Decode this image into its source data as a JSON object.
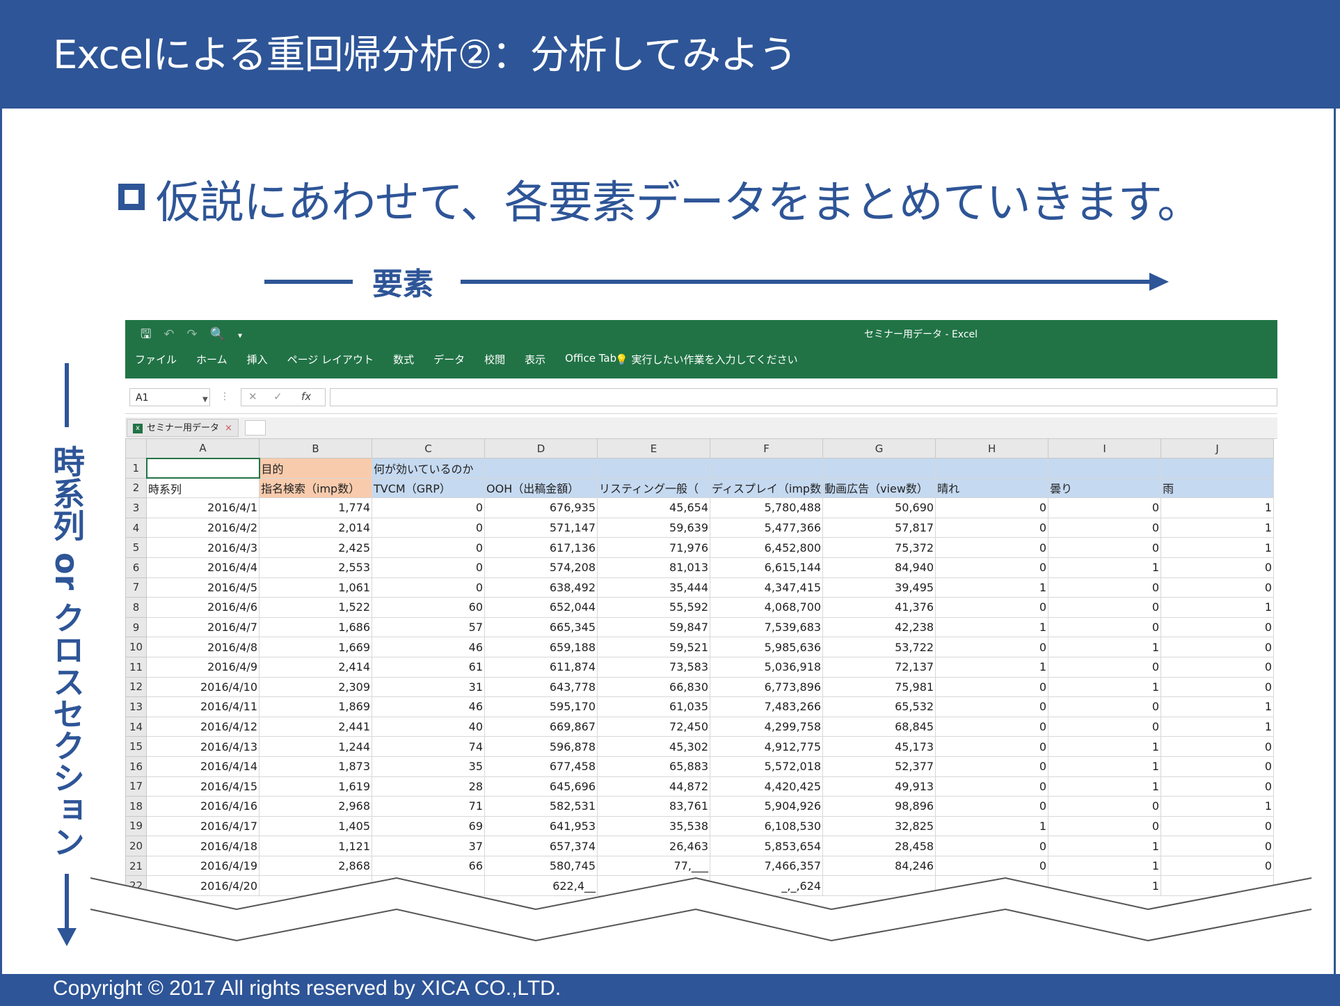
{
  "slide": {
    "title": "Excelによる重回帰分析②：分析してみよう",
    "headline": "仮説にあわせて、各要素データをまとめていきます。",
    "element_label": "要素",
    "side_label": "時系列 or クロスセクション",
    "footer": "Copyright © 2017 All rights reserved by XICA CO.,LTD.",
    "colors": {
      "brand": "#2e5597",
      "excel_green": "#217346",
      "header_blue": "#c5d9f0",
      "header_orange": "#f8cbad"
    }
  },
  "excel": {
    "window_title": "セミナー用データ - Excel",
    "menu": [
      "ファイル",
      "ホーム",
      "挿入",
      "ページ レイアウト",
      "数式",
      "データ",
      "校閲",
      "表示",
      "Office Tab"
    ],
    "tell_me": "実行したい作業を入力してください",
    "name_box": "A1",
    "doc_tab": "セミナー用データ",
    "columns": [
      "A",
      "B",
      "C",
      "D",
      "E",
      "F",
      "G",
      "H",
      "I",
      "J"
    ],
    "row1": [
      "",
      "目的",
      "何が効いているのか",
      "",
      "",
      "",
      "",
      "",
      "",
      ""
    ],
    "row2": [
      "時系列",
      "指名検索（imp数）",
      "TVCM（GRP）",
      "OOH（出稿金額）",
      "リスティング一般（",
      "ディスプレイ（imp数",
      "動画広告（view数）",
      "晴れ",
      "曇り",
      "雨"
    ],
    "rows": [
      [
        "2016/4/1",
        "1,774",
        "0",
        "676,935",
        "45,654",
        "5,780,488",
        "50,690",
        "0",
        "0",
        "1"
      ],
      [
        "2016/4/2",
        "2,014",
        "0",
        "571,147",
        "59,639",
        "5,477,366",
        "57,817",
        "0",
        "0",
        "1"
      ],
      [
        "2016/4/3",
        "2,425",
        "0",
        "617,136",
        "71,976",
        "6,452,800",
        "75,372",
        "0",
        "0",
        "1"
      ],
      [
        "2016/4/4",
        "2,553",
        "0",
        "574,208",
        "81,013",
        "6,615,144",
        "84,940",
        "0",
        "1",
        "0"
      ],
      [
        "2016/4/5",
        "1,061",
        "0",
        "638,492",
        "35,444",
        "4,347,415",
        "39,495",
        "1",
        "0",
        "0"
      ],
      [
        "2016/4/6",
        "1,522",
        "60",
        "652,044",
        "55,592",
        "4,068,700",
        "41,376",
        "0",
        "0",
        "1"
      ],
      [
        "2016/4/7",
        "1,686",
        "57",
        "665,345",
        "59,847",
        "7,539,683",
        "42,238",
        "1",
        "0",
        "0"
      ],
      [
        "2016/4/8",
        "1,669",
        "46",
        "659,188",
        "59,521",
        "5,985,636",
        "53,722",
        "0",
        "1",
        "0"
      ],
      [
        "2016/4/9",
        "2,414",
        "61",
        "611,874",
        "73,583",
        "5,036,918",
        "72,137",
        "1",
        "0",
        "0"
      ],
      [
        "2016/4/10",
        "2,309",
        "31",
        "643,778",
        "66,830",
        "6,773,896",
        "75,981",
        "0",
        "1",
        "0"
      ],
      [
        "2016/4/11",
        "1,869",
        "46",
        "595,170",
        "61,035",
        "7,483,266",
        "65,532",
        "0",
        "0",
        "1"
      ],
      [
        "2016/4/12",
        "2,441",
        "40",
        "669,867",
        "72,450",
        "4,299,758",
        "68,845",
        "0",
        "0",
        "1"
      ],
      [
        "2016/4/13",
        "1,244",
        "74",
        "596,878",
        "45,302",
        "4,912,775",
        "45,173",
        "0",
        "1",
        "0"
      ],
      [
        "2016/4/14",
        "1,873",
        "35",
        "677,458",
        "65,883",
        "5,572,018",
        "52,377",
        "0",
        "1",
        "0"
      ],
      [
        "2016/4/15",
        "1,619",
        "28",
        "645,696",
        "44,872",
        "4,420,425",
        "49,913",
        "0",
        "1",
        "0"
      ],
      [
        "2016/4/16",
        "2,968",
        "71",
        "582,531",
        "83,761",
        "5,904,926",
        "98,896",
        "0",
        "0",
        "1"
      ],
      [
        "2016/4/17",
        "1,405",
        "69",
        "641,953",
        "35,538",
        "6,108,530",
        "32,825",
        "1",
        "0",
        "0"
      ],
      [
        "2016/4/18",
        "1,121",
        "37",
        "657,374",
        "26,463",
        "5,853,654",
        "28,458",
        "0",
        "1",
        "0"
      ],
      [
        "2016/4/19",
        "2,868",
        "66",
        "580,745",
        "77,___",
        "7,466,357",
        "84,246",
        "0",
        "1",
        "0"
      ],
      [
        "2016/4/20",
        "",
        "",
        "622,4__",
        "",
        "_,_,624",
        "",
        "",
        "1",
        ""
      ]
    ]
  }
}
